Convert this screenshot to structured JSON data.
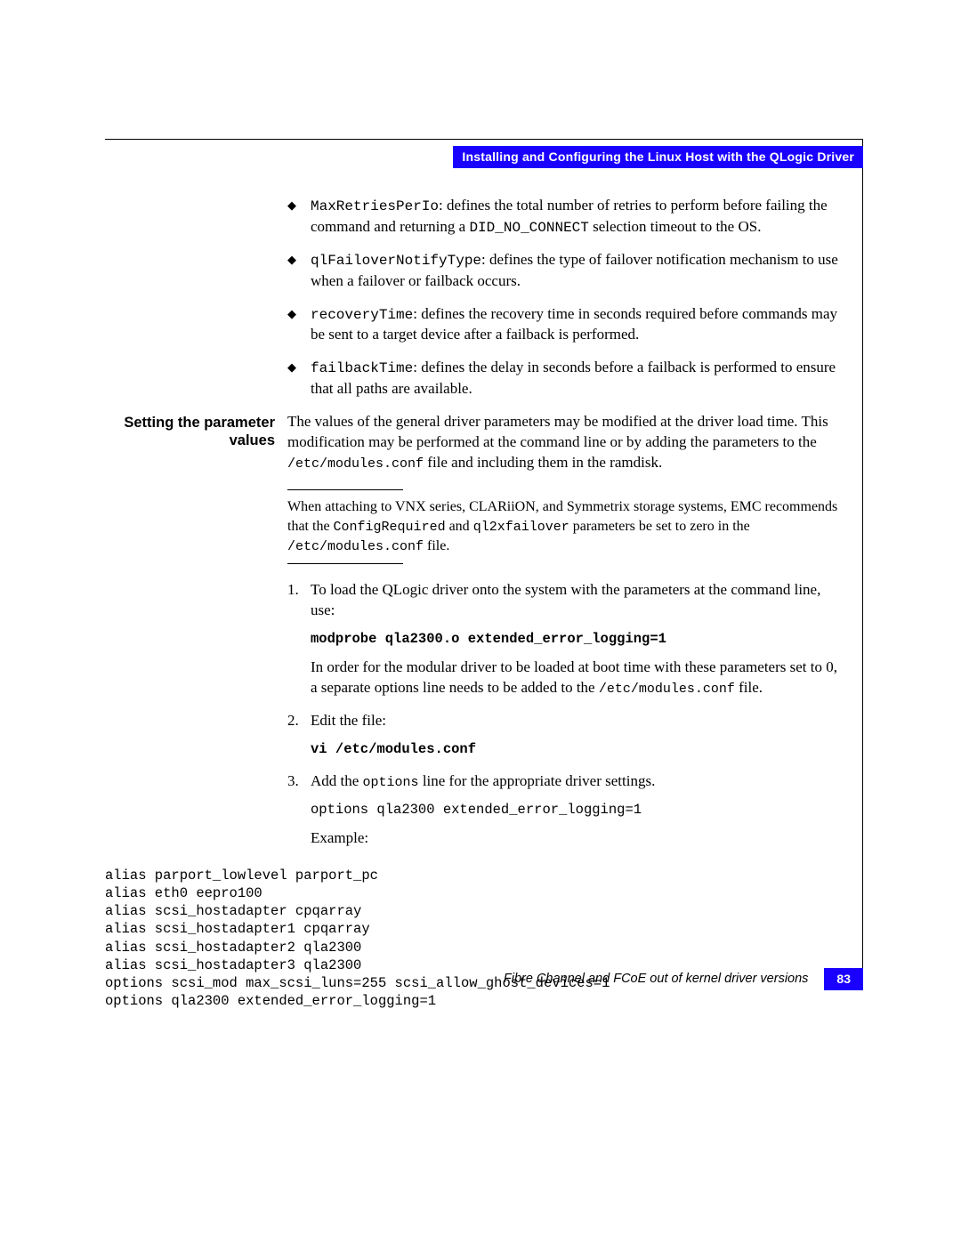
{
  "header": {
    "title": "Installing and Configuring the Linux Host with the QLogic Driver"
  },
  "bullets": [
    {
      "term": "MaxRetriesPerIo",
      "desc_before": ": defines the total number of retries to perform before failing the command and returning a ",
      "code2": "DID_NO_CONNECT",
      "desc_after": " selection timeout to the OS."
    },
    {
      "term": "qlFailoverNotifyType",
      "desc_before": ": defines the type of failover notification mechanism to use when a failover or failback occurs.",
      "code2": "",
      "desc_after": ""
    },
    {
      "term": "recoveryTime",
      "desc_before": ": defines the recovery time in seconds required before commands may be sent to a target device after a failback is performed.",
      "code2": "",
      "desc_after": ""
    },
    {
      "term": "failbackTime",
      "desc_before": ": defines the delay in seconds before a failback is performed to ensure that all paths are available.",
      "code2": "",
      "desc_after": ""
    }
  ],
  "section": {
    "margin_heading": "Setting the parameter values",
    "intro_a": "The values of the general driver parameters may be modified at the driver load time. This modification may be performed at the command line or by adding the parameters to the ",
    "intro_code": "/etc/modules.conf",
    "intro_b": " file and including them in the ramdisk."
  },
  "note": {
    "a": "When attaching to VNX series, CLARiiON, and Symmetrix storage systems, EMC recommends that the ",
    "c1": "ConfigRequired",
    "mid": " and ",
    "c2": "ql2xfailover",
    "b": " parameters be set to zero in the ",
    "c3": "/etc/modules.conf",
    "end": " file."
  },
  "steps": {
    "s1_text": "To load the QLogic driver onto the system with the parameters at the command line, use:",
    "s1_cmd": "modprobe qla2300.o extended_error_logging=1",
    "s1_post_a": "In order for the modular driver to be loaded at boot time with these parameters set to 0, a separate options line needs to be added to the ",
    "s1_post_code": "/etc/modules.conf",
    "s1_post_b": " file.",
    "s2_text": "Edit the file:",
    "s2_cmd": "vi /etc/modules.conf",
    "s3_a": "Add the ",
    "s3_code": "options",
    "s3_b": " line for the appropriate driver settings.",
    "s3_cmd": "options qla2300 extended_error_logging=1",
    "example_label": "Example:"
  },
  "example_block": "alias parport_lowlevel parport_pc\nalias eth0 eepro100\nalias scsi_hostadapter cpqarray\nalias scsi_hostadapter1 cpqarray\nalias scsi_hostadapter2 qla2300\nalias scsi_hostadapter3 qla2300\noptions scsi_mod max_scsi_luns=255 scsi_allow_ghost_devices=1\noptions qla2300 extended_error_logging=1",
  "footer": {
    "text": "Fibre Channel and FCoE out of kernel driver versions",
    "page": "83"
  }
}
